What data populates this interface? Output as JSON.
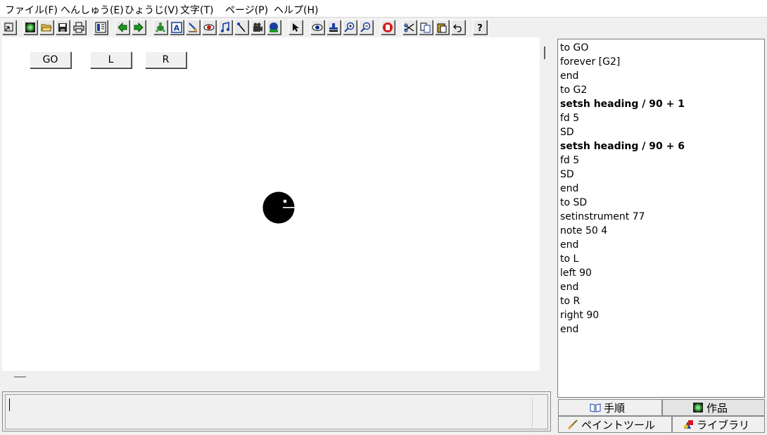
{
  "menu": [
    "ファイル(F)",
    "へんしゅう(E)",
    "ひょうじ(V)",
    "文字(T)",
    "ページ(P)",
    "ヘルプ(H)"
  ],
  "toolbar_icons": [
    "new-page-icon",
    "globe-icon",
    "open-folder-icon",
    "save-icon",
    "print-icon",
    "page-list-icon",
    "arrow-left-icon",
    "arrow-right-icon",
    "turtle-icon",
    "text-box-icon",
    "paint-icon",
    "eye-color-icon",
    "music-note-icon",
    "melody-icon",
    "movie-icon",
    "globe-blue-icon",
    "pointer-icon",
    "eye-icon",
    "stamp-icon",
    "zoom-in-icon",
    "zoom-out-icon",
    "hand-stop-icon",
    "scissors-icon",
    "copy-icon",
    "paste-icon",
    "undo-icon",
    "help-icon"
  ],
  "canvas_buttons": {
    "go": "GO",
    "l": "L",
    "r": "R"
  },
  "procedures": [
    {
      "text": "to GO",
      "bold": false
    },
    {
      "text": "forever [G2]",
      "bold": false
    },
    {
      "text": "end",
      "bold": false
    },
    {
      "text": "to G2",
      "bold": false
    },
    {
      "text": "setsh heading / 90 + 1",
      "bold": true
    },
    {
      "text": "fd 5",
      "bold": false
    },
    {
      "text": "SD",
      "bold": false
    },
    {
      "text": "setsh heading / 90 + 6",
      "bold": true
    },
    {
      "text": "fd 5",
      "bold": false
    },
    {
      "text": "SD",
      "bold": false
    },
    {
      "text": "end",
      "bold": false
    },
    {
      "text": "to SD",
      "bold": false
    },
    {
      "text": "setinstrument 77",
      "bold": false
    },
    {
      "text": "note 50 4",
      "bold": false
    },
    {
      "text": "end",
      "bold": false
    },
    {
      "text": "to L",
      "bold": false
    },
    {
      "text": "left 90",
      "bold": false
    },
    {
      "text": "end",
      "bold": false
    },
    {
      "text": "to R",
      "bold": false
    },
    {
      "text": "right 90",
      "bold": false
    },
    {
      "text": "end",
      "bold": false
    }
  ],
  "tabs": {
    "procedures": "手順",
    "projects": "作品",
    "paint": "ペイントツール",
    "library": "ライブラリ"
  },
  "colors": {
    "accent_green": "#1a8a1a",
    "turtle": "#000000"
  }
}
